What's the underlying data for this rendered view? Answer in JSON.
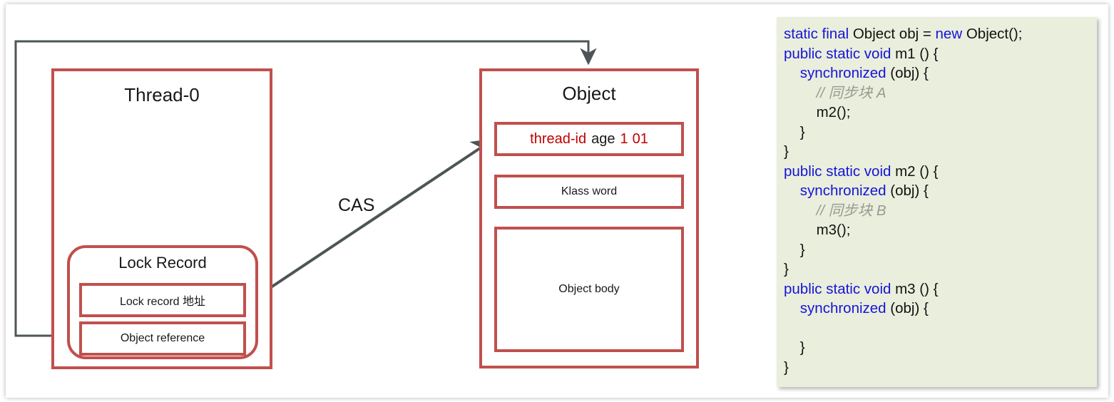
{
  "diagram": {
    "thread_box": {
      "title": "Thread-0"
    },
    "lock_record": {
      "title": "Lock Record",
      "rows": [
        {
          "label": "Lock record 地址"
        },
        {
          "label": "Object reference"
        }
      ]
    },
    "object_box": {
      "title": "Object",
      "mark_word": {
        "thread_id": "thread-id",
        "age": "age",
        "biased_flag": "1",
        "lock_bits": "01"
      },
      "klass_word": "Klass word",
      "object_body": "Object body"
    },
    "cas_label": "CAS",
    "colors": {
      "box_border": "#C0504D",
      "arrow": "#4D5656",
      "highlight_text": "#C00000",
      "code_bg": "#EAEEDC",
      "code_keyword": "#1515D8",
      "code_comment": "#9A9A92"
    }
  },
  "code": {
    "lines": [
      [
        {
          "t": "static final ",
          "c": "kw"
        },
        {
          "t": "Object obj = ",
          "c": ""
        },
        {
          "t": "new ",
          "c": "kw"
        },
        {
          "t": "Object();",
          "c": ""
        }
      ],
      [
        {
          "t": "public static void ",
          "c": "kw"
        },
        {
          "t": "m1 () {",
          "c": ""
        }
      ],
      [
        {
          "t": "    ",
          "c": ""
        },
        {
          "t": "synchronized ",
          "c": "kw"
        },
        {
          "t": "(obj) {",
          "c": ""
        }
      ],
      [
        {
          "t": "        // 同步块 A",
          "c": "cm"
        }
      ],
      [
        {
          "t": "        m2();",
          "c": ""
        }
      ],
      [
        {
          "t": "    }",
          "c": ""
        }
      ],
      [
        {
          "t": "}",
          "c": ""
        }
      ],
      [
        {
          "t": "public static void ",
          "c": "kw"
        },
        {
          "t": "m2 () {",
          "c": ""
        }
      ],
      [
        {
          "t": "    ",
          "c": ""
        },
        {
          "t": "synchronized ",
          "c": "kw"
        },
        {
          "t": "(obj) {",
          "c": ""
        }
      ],
      [
        {
          "t": "        // 同步块 B",
          "c": "cm"
        }
      ],
      [
        {
          "t": "        m3();",
          "c": ""
        }
      ],
      [
        {
          "t": "    }",
          "c": ""
        }
      ],
      [
        {
          "t": "}",
          "c": ""
        }
      ],
      [
        {
          "t": "public static void ",
          "c": "kw"
        },
        {
          "t": "m3 () {",
          "c": ""
        }
      ],
      [
        {
          "t": "    ",
          "c": ""
        },
        {
          "t": "synchronized ",
          "c": "kw"
        },
        {
          "t": "(obj) {",
          "c": ""
        }
      ],
      [
        {
          "t": "",
          "c": ""
        }
      ],
      [
        {
          "t": "    }",
          "c": ""
        }
      ],
      [
        {
          "t": "}",
          "c": ""
        }
      ]
    ]
  }
}
